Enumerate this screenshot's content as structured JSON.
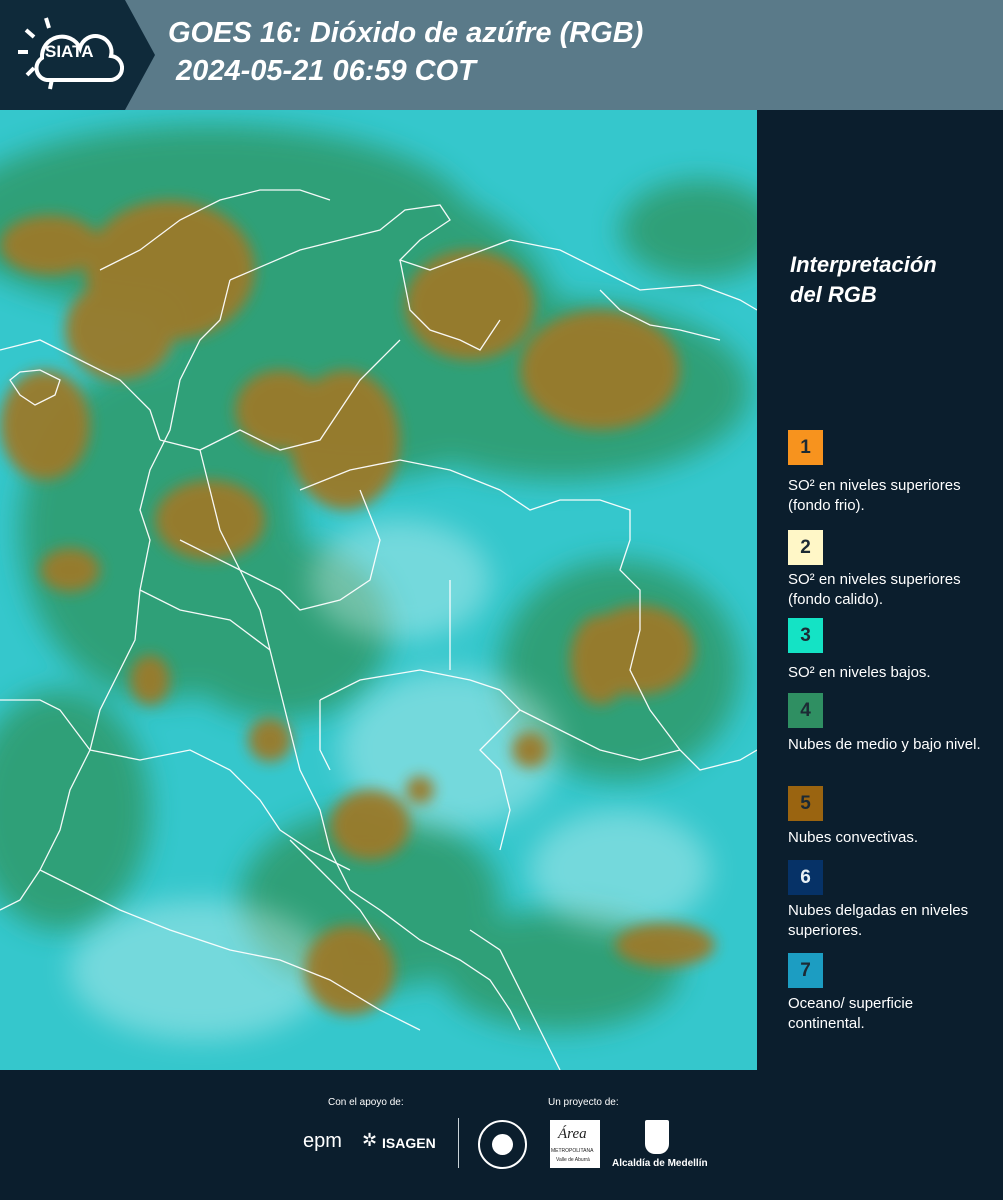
{
  "header": {
    "logo_text": "SIATA",
    "title_line1": "GOES 16: Dióxido de azúfre (RGB)",
    "title_line2": " 2024-05-21 06:59 COT"
  },
  "legend": {
    "title_line1": "Interpretación",
    "title_line2": "del RGB",
    "items": [
      {
        "num": "1",
        "color": "#f7931e",
        "label": "SO² en niveles superiores (fondo frio)."
      },
      {
        "num": "2",
        "color": "#fff7c7",
        "label": "SO² en niveles superiores (fondo calido)."
      },
      {
        "num": "3",
        "color": "#14e3c5",
        "label": "SO² en niveles bajos."
      },
      {
        "num": "4",
        "color": "#2f8f62",
        "label": "Nubes de medio y bajo nivel."
      },
      {
        "num": "5",
        "color": "#9a6410",
        "label": "Nubes convectivas."
      },
      {
        "num": "6",
        "color": "#063267",
        "label": "Nubes delgadas en niveles superiores."
      },
      {
        "num": "7",
        "color": "#1c9dc2",
        "label": "Oceano/ superficie continental."
      }
    ]
  },
  "footer": {
    "support_label": "Con el apoyo de:",
    "project_label": "Un proyecto de:",
    "epm": "epm",
    "isagen": "ISAGEN",
    "area_text": "Área",
    "area_sub1": "METROPOLITANA",
    "area_sub2": "Valle de Aburrá",
    "alcaldia": "Alcaldía de Medellín"
  },
  "colors": {
    "header_bg": "#5a7a89",
    "logo_bg": "#0f2a3a",
    "panel_bg": "#0b1e2d",
    "map_cyan": "#32c6cd",
    "map_green": "#2e9a6a",
    "map_brown": "#9b7a2c"
  }
}
